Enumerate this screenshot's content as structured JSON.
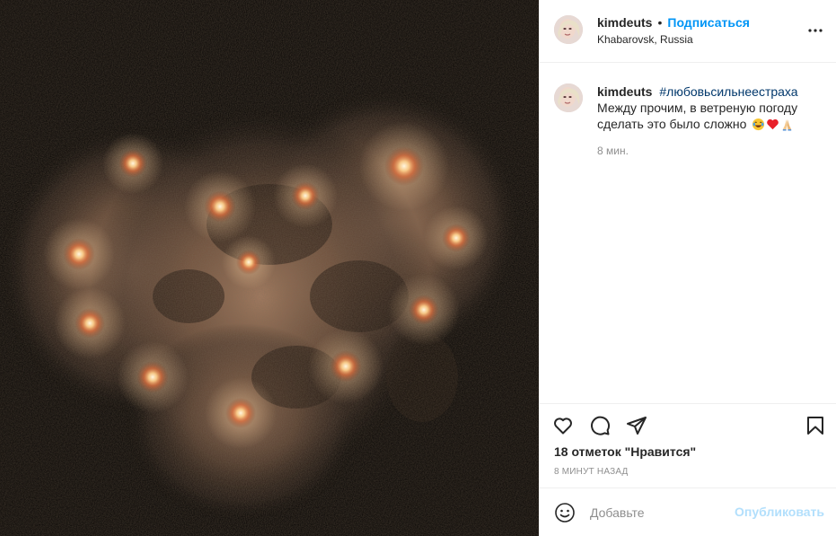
{
  "post": {
    "photo": {
      "icon": "candles-heart-photo"
    },
    "author": {
      "username": "kimdeuts",
      "separator": "•",
      "follow_label": "Подписаться",
      "location": "Khabarovsk, Russia"
    },
    "caption": {
      "username": "kimdeuts",
      "hashtag": "#любовьсильнеестраха",
      "text": "Между прочим, в ветреную погоду сделать это было сложно",
      "emojis": [
        "face-with-tears-of-joy",
        "red-heart",
        "folded-hands"
      ]
    },
    "caption_age": "8 мин.",
    "actions": {
      "icons": [
        "heart-icon",
        "comment-icon",
        "share-icon",
        "bookmark-icon"
      ]
    },
    "likes_text": "18 отметок \"Нравится\"",
    "timestamp": "8 минут назад",
    "comment_box": {
      "placeholder": "Добавьте",
      "publish_label": "Опубликовать"
    }
  },
  "colors": {
    "link": "#0095f6",
    "hashtag": "#00376b",
    "muted": "#8e8e8e",
    "publish_disabled": "#b2dffc",
    "border": "#efefef"
  }
}
